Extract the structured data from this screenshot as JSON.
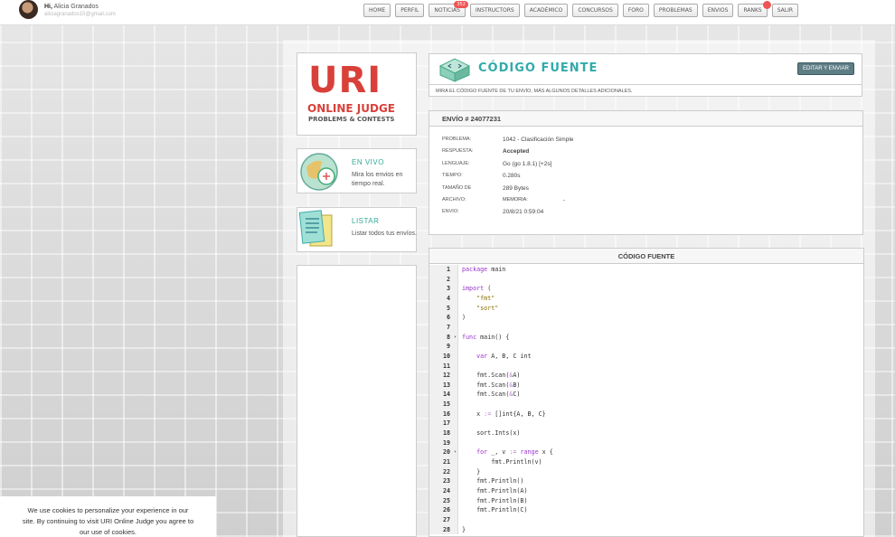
{
  "user": {
    "greeting_prefix": "Hi,",
    "name": "Alicia Granados",
    "email": "aliciagranados15@gmail.com"
  },
  "nav": {
    "items": [
      "HOME",
      "PERFIL",
      "NOTICIAS",
      "INSTRUCTORS",
      "ACADÉMICO",
      "CONCURSOS",
      "FORO",
      "PROBLEMAS",
      "ENVIOS",
      "RANKS",
      "SALIR"
    ],
    "noticias_badge": "352"
  },
  "logo": {
    "main": "URI",
    "line2": "ONLINE JUDGE",
    "line3": "PROBLEMS & CONTESTS"
  },
  "sidebar": {
    "envivo": {
      "title": "EN VIVO",
      "desc": "Mira los envios en tiempo real."
    },
    "listar": {
      "title": "LISTAR",
      "desc": "Listar todos tus envíos."
    }
  },
  "header": {
    "title": "CÓDIGO FUENTE",
    "subtitle": "MIRA EL CÓDIGO FUENTE DE TU ENVÍO, MÁS ALGUNOS DETALLES ADICIONALES.",
    "edit_button": "EDITAR Y ENVIAR"
  },
  "submission": {
    "title": "ENVÍO # 24077231",
    "fields": [
      {
        "label": "PROBLEMA:",
        "value": "1042 - Clasificación Simple"
      },
      {
        "label": "RESPUESTA:",
        "value": "Accepted"
      },
      {
        "label": "LENGUAJE:",
        "value": "Go (go 1.8.1) [+2s]"
      },
      {
        "label": "TIEMPO:",
        "value": "0.280s"
      },
      {
        "label": "TAMAÑO DE",
        "value": "289 Bytes"
      },
      {
        "label": "ARCHIVO:",
        "value": "MEMORIA:",
        "extra": "-"
      },
      {
        "label": "ENVIO:",
        "value": "20/8/21 0:59:04"
      }
    ]
  },
  "code": {
    "title": "CÓDIGO FUENTE",
    "lines": [
      "package main",
      "",
      "import (",
      "    \"fmt\"",
      "    \"sort\"",
      ")",
      "",
      "func main() {",
      "",
      "    var A, B, C int",
      "",
      "    fmt.Scan(&A)",
      "    fmt.Scan(&B)",
      "    fmt.Scan(&C)",
      "",
      "    x := []int{A, B, C}",
      "",
      "    sort.Ints(x)",
      "",
      "    for _, v := range x {",
      "        fmt.Println(v)",
      "    }",
      "    fmt.Println()",
      "    fmt.Println(A)",
      "    fmt.Println(B)",
      "    fmt.Println(C)",
      "",
      "}"
    ],
    "fold_lines": [
      8,
      20
    ]
  },
  "cookie": {
    "line1": "We use cookies to personalize your experience in our",
    "line2": "site. By continuing to visit URI Online Judge you agree to",
    "line3": "our use of cookies."
  }
}
